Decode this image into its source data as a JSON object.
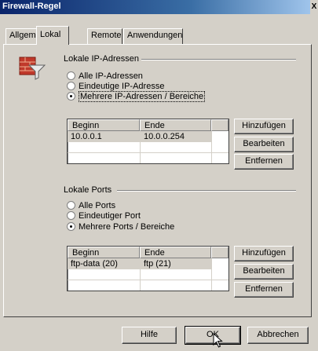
{
  "window": {
    "title": "Firewall-Regel",
    "close_glyph": "X"
  },
  "tabs": [
    {
      "label": "Allgemein"
    },
    {
      "label": "Lokal"
    },
    {
      "label": "Remote"
    },
    {
      "label": "Anwendungen"
    }
  ],
  "local_ip": {
    "heading": "Lokale IP-Adressen",
    "icon": "firewall-icon",
    "options": [
      {
        "label": "Alle IP-Adressen",
        "checked": false
      },
      {
        "label": "Eindeutige IP-Adresse",
        "checked": false
      },
      {
        "label": "Mehrere IP-Adressen / Bereiche",
        "checked": true
      }
    ],
    "columns": [
      "Beginn",
      "Ende"
    ],
    "rows": [
      {
        "begin": "10.0.0.1",
        "end": "10.0.0.254"
      }
    ],
    "buttons": {
      "add": "Hinzufügen",
      "edit": "Bearbeiten",
      "remove": "Entfernen"
    }
  },
  "local_ports": {
    "heading": "Lokale Ports",
    "options": [
      {
        "label": "Alle Ports",
        "checked": false
      },
      {
        "label": "Eindeutiger Port",
        "checked": false
      },
      {
        "label": "Mehrere Ports / Bereiche",
        "checked": true
      }
    ],
    "columns": [
      "Beginn",
      "Ende"
    ],
    "rows": [
      {
        "begin": "ftp-data (20)",
        "end": "ftp (21)"
      }
    ],
    "buttons": {
      "add": "Hinzufügen",
      "edit": "Bearbeiten",
      "remove": "Entfernen"
    }
  },
  "footer": {
    "help": "Hilfe",
    "ok": "OK",
    "cancel": "Abbrechen"
  }
}
